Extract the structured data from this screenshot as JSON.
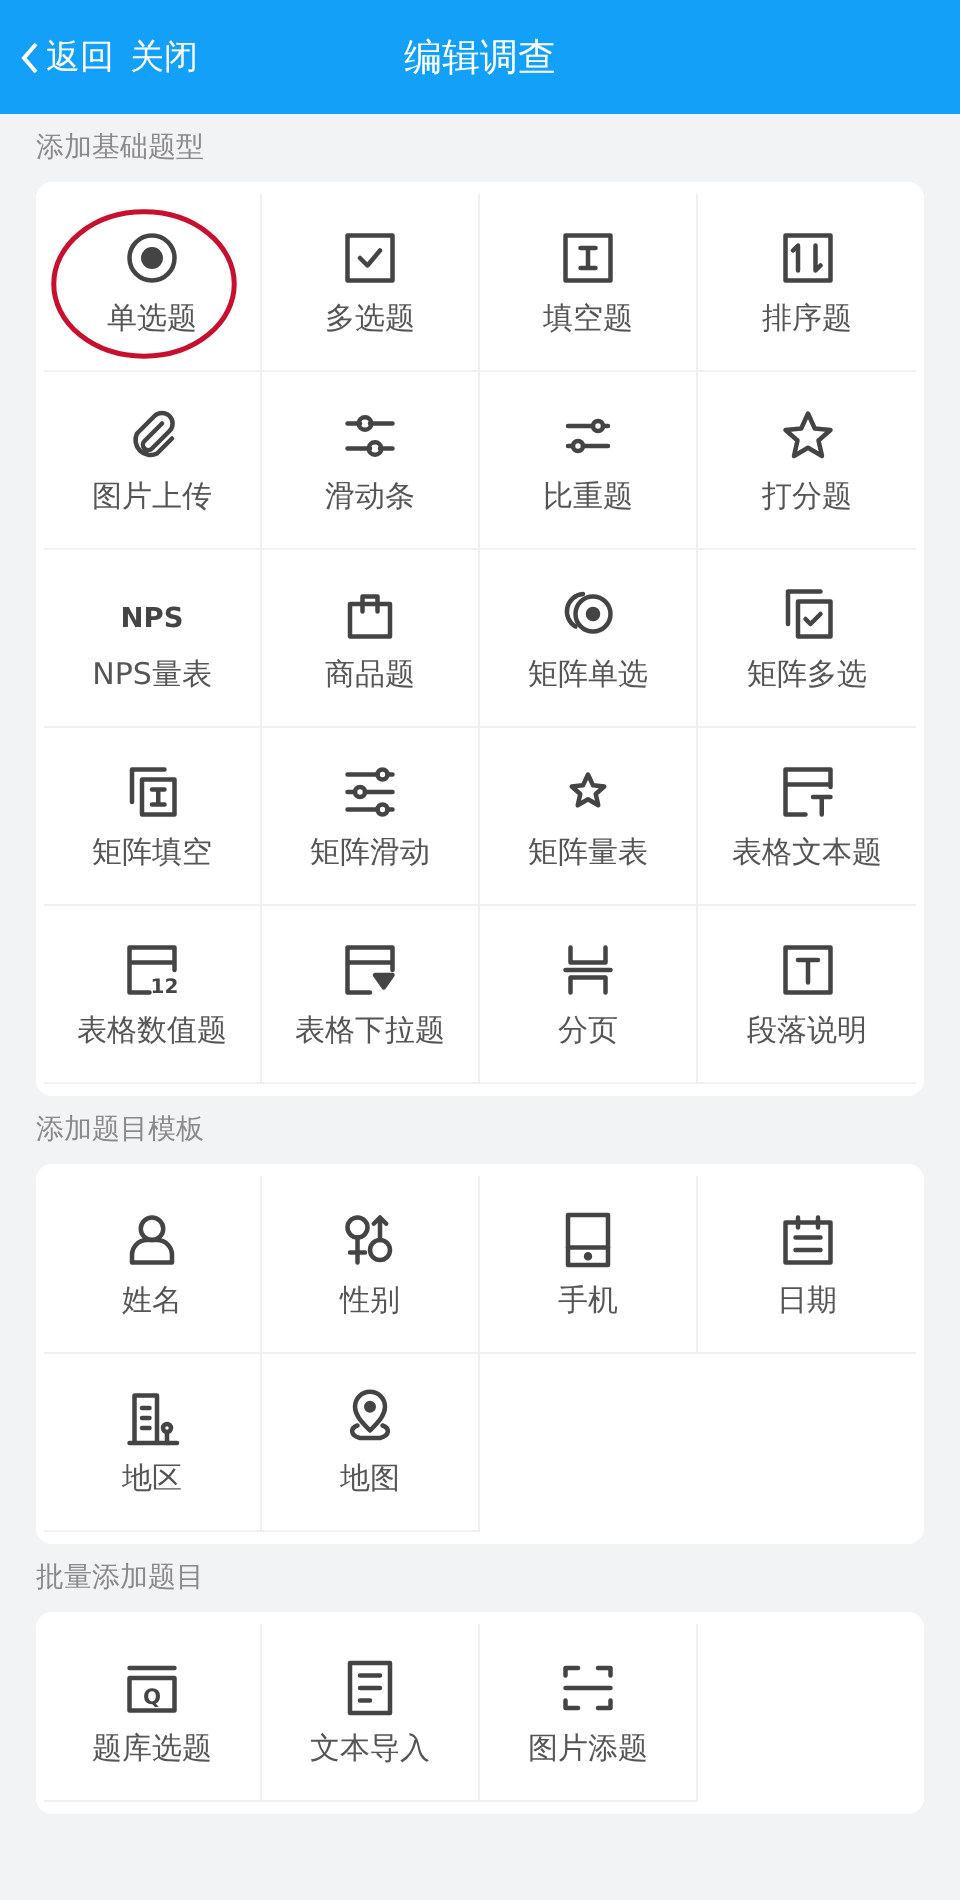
{
  "header": {
    "back": "返回",
    "close": "关闭",
    "title": "编辑调查"
  },
  "sections": [
    {
      "title": "添加基础题型",
      "items": [
        {
          "label": "单选题",
          "kind": "radio",
          "circled": true
        },
        {
          "label": "多选题",
          "kind": "checkbox",
          "circled": false
        },
        {
          "label": "填空题",
          "kind": "text-box",
          "circled": false
        },
        {
          "label": "排序题",
          "kind": "sort",
          "circled": false
        },
        {
          "label": "图片上传",
          "kind": "clip",
          "circled": false
        },
        {
          "label": "滑动条",
          "kind": "slider",
          "circled": false
        },
        {
          "label": "比重题",
          "kind": "weight",
          "circled": false
        },
        {
          "label": "打分题",
          "kind": "star",
          "circled": false
        },
        {
          "label": "NPS量表",
          "kind": "nps",
          "icon_text": "NPS",
          "circled": false
        },
        {
          "label": "商品题",
          "kind": "bag",
          "circled": false
        },
        {
          "label": "矩阵单选",
          "kind": "matrix-radio",
          "circled": false
        },
        {
          "label": "矩阵多选",
          "kind": "matrix-check",
          "circled": false
        },
        {
          "label": "矩阵填空",
          "kind": "matrix-text",
          "circled": false
        },
        {
          "label": "矩阵滑动",
          "kind": "matrix-slider",
          "circled": false
        },
        {
          "label": "矩阵量表",
          "kind": "matrix-star",
          "circled": false
        },
        {
          "label": "表格文本题",
          "kind": "table-text",
          "circled": false
        },
        {
          "label": "表格数值题",
          "kind": "table-number",
          "icon_text": "12",
          "circled": false
        },
        {
          "label": "表格下拉题",
          "kind": "table-dropdown",
          "circled": false
        },
        {
          "label": "分页",
          "kind": "page-break",
          "circled": false
        },
        {
          "label": "段落说明",
          "kind": "paragraph",
          "circled": false
        }
      ]
    },
    {
      "title": "添加题目模板",
      "items": [
        {
          "label": "姓名",
          "kind": "person",
          "circled": false
        },
        {
          "label": "性别",
          "kind": "gender",
          "circled": false
        },
        {
          "label": "手机",
          "kind": "phone",
          "circled": false
        },
        {
          "label": "日期",
          "kind": "calendar",
          "circled": false
        },
        {
          "label": "地区",
          "kind": "building",
          "circled": false
        },
        {
          "label": "地图",
          "kind": "pin",
          "circled": false
        }
      ]
    },
    {
      "title": "批量添加题目",
      "items": [
        {
          "label": "题库选题",
          "kind": "bank",
          "icon_text": "Q",
          "circled": false
        },
        {
          "label": "文本导入",
          "kind": "document",
          "circled": false
        },
        {
          "label": "图片添题",
          "kind": "scan",
          "circled": false
        }
      ]
    }
  ]
}
